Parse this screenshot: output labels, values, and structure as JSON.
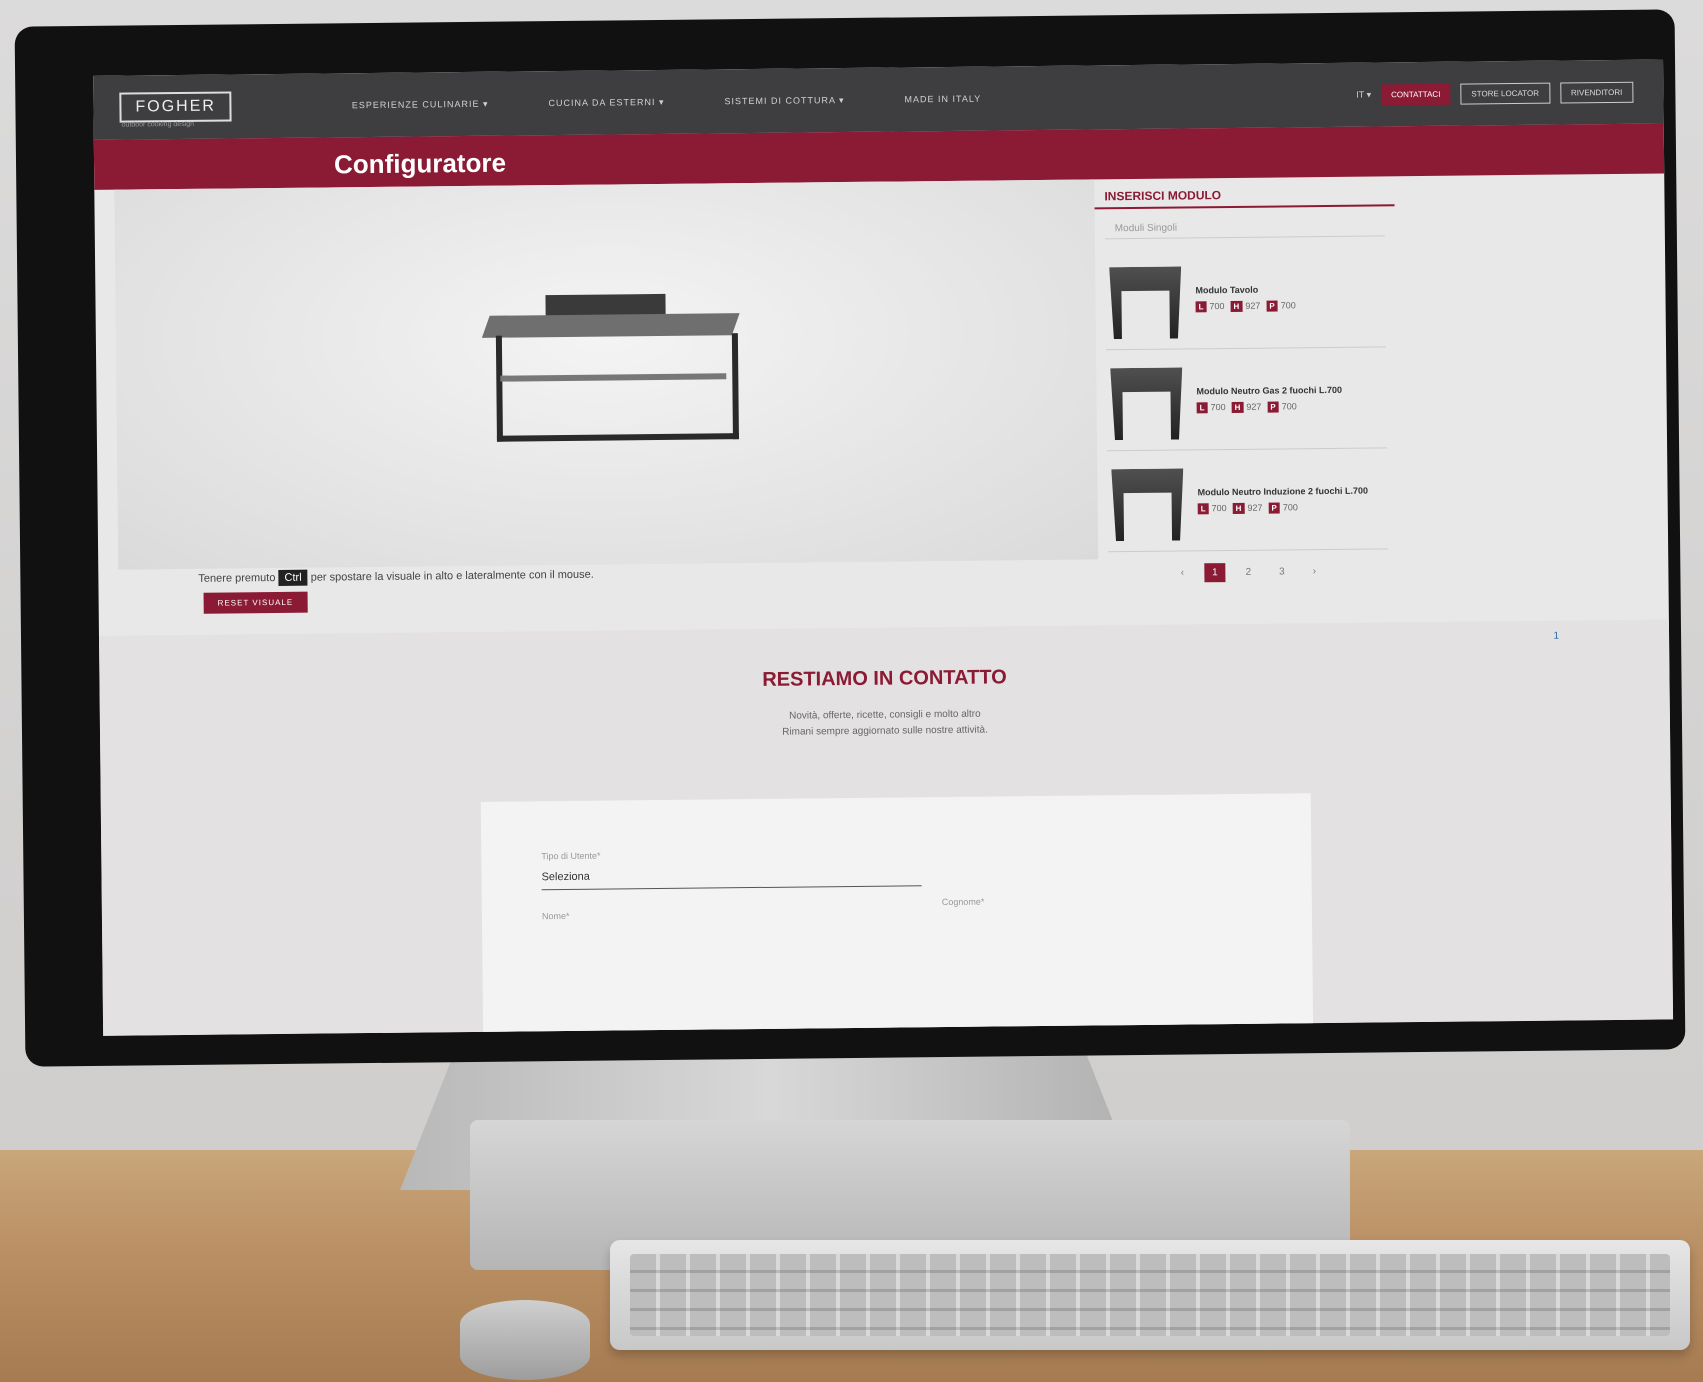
{
  "site": {
    "logo": "FOGHER",
    "logo_tagline": "outdoor cooking design",
    "nav": [
      "ESPERIENZE CULINARIE ▾",
      "CUCINA DA ESTERNI ▾",
      "SISTEMI DI COTTURA ▾",
      "MADE IN ITALY"
    ],
    "lang": "IT ▾",
    "contact_btn": "CONTATTACI",
    "store_btn": "STORE LOCATOR",
    "dealer_btn": "RIVENDITORI"
  },
  "page": {
    "title": "Configuratore"
  },
  "viewer": {
    "hint_before": "Tenere premuto",
    "hint_key": "Ctrl",
    "hint_after": "per spostare la visuale in alto e lateralmente con il mouse.",
    "reset_btn": "RESET VISUALE"
  },
  "sidebar": {
    "title": "INSERISCI MODULO",
    "select_value": "Moduli Singoli",
    "modules": [
      {
        "name": "Modulo Tavolo",
        "dims": [
          "700",
          "927",
          "700"
        ]
      },
      {
        "name": "Modulo Neutro Gas 2 fuochi L.700",
        "dims": [
          "700",
          "927",
          "700"
        ]
      },
      {
        "name": "Modulo Neutro Induzione 2 fuochi L.700",
        "dims": [
          "700",
          "927",
          "700"
        ]
      }
    ],
    "dim_letters": [
      "L",
      "H",
      "P"
    ],
    "pages": [
      "‹",
      "1",
      "2",
      "3",
      "›"
    ]
  },
  "contact": {
    "title": "RESTIAMO IN CONTATTO",
    "text1": "Novità, offerte, ricette, consigli e molto altro",
    "text2": "Rimani sempre aggiornato sulle nostre attività.",
    "type_label": "Tipo di Utente*",
    "type_value": "Seleziona",
    "name_label": "Nome*",
    "surname_label": "Cognome*",
    "badge": "1"
  },
  "colors": {
    "brand": "#8b1a34",
    "header": "#3e3e40"
  }
}
